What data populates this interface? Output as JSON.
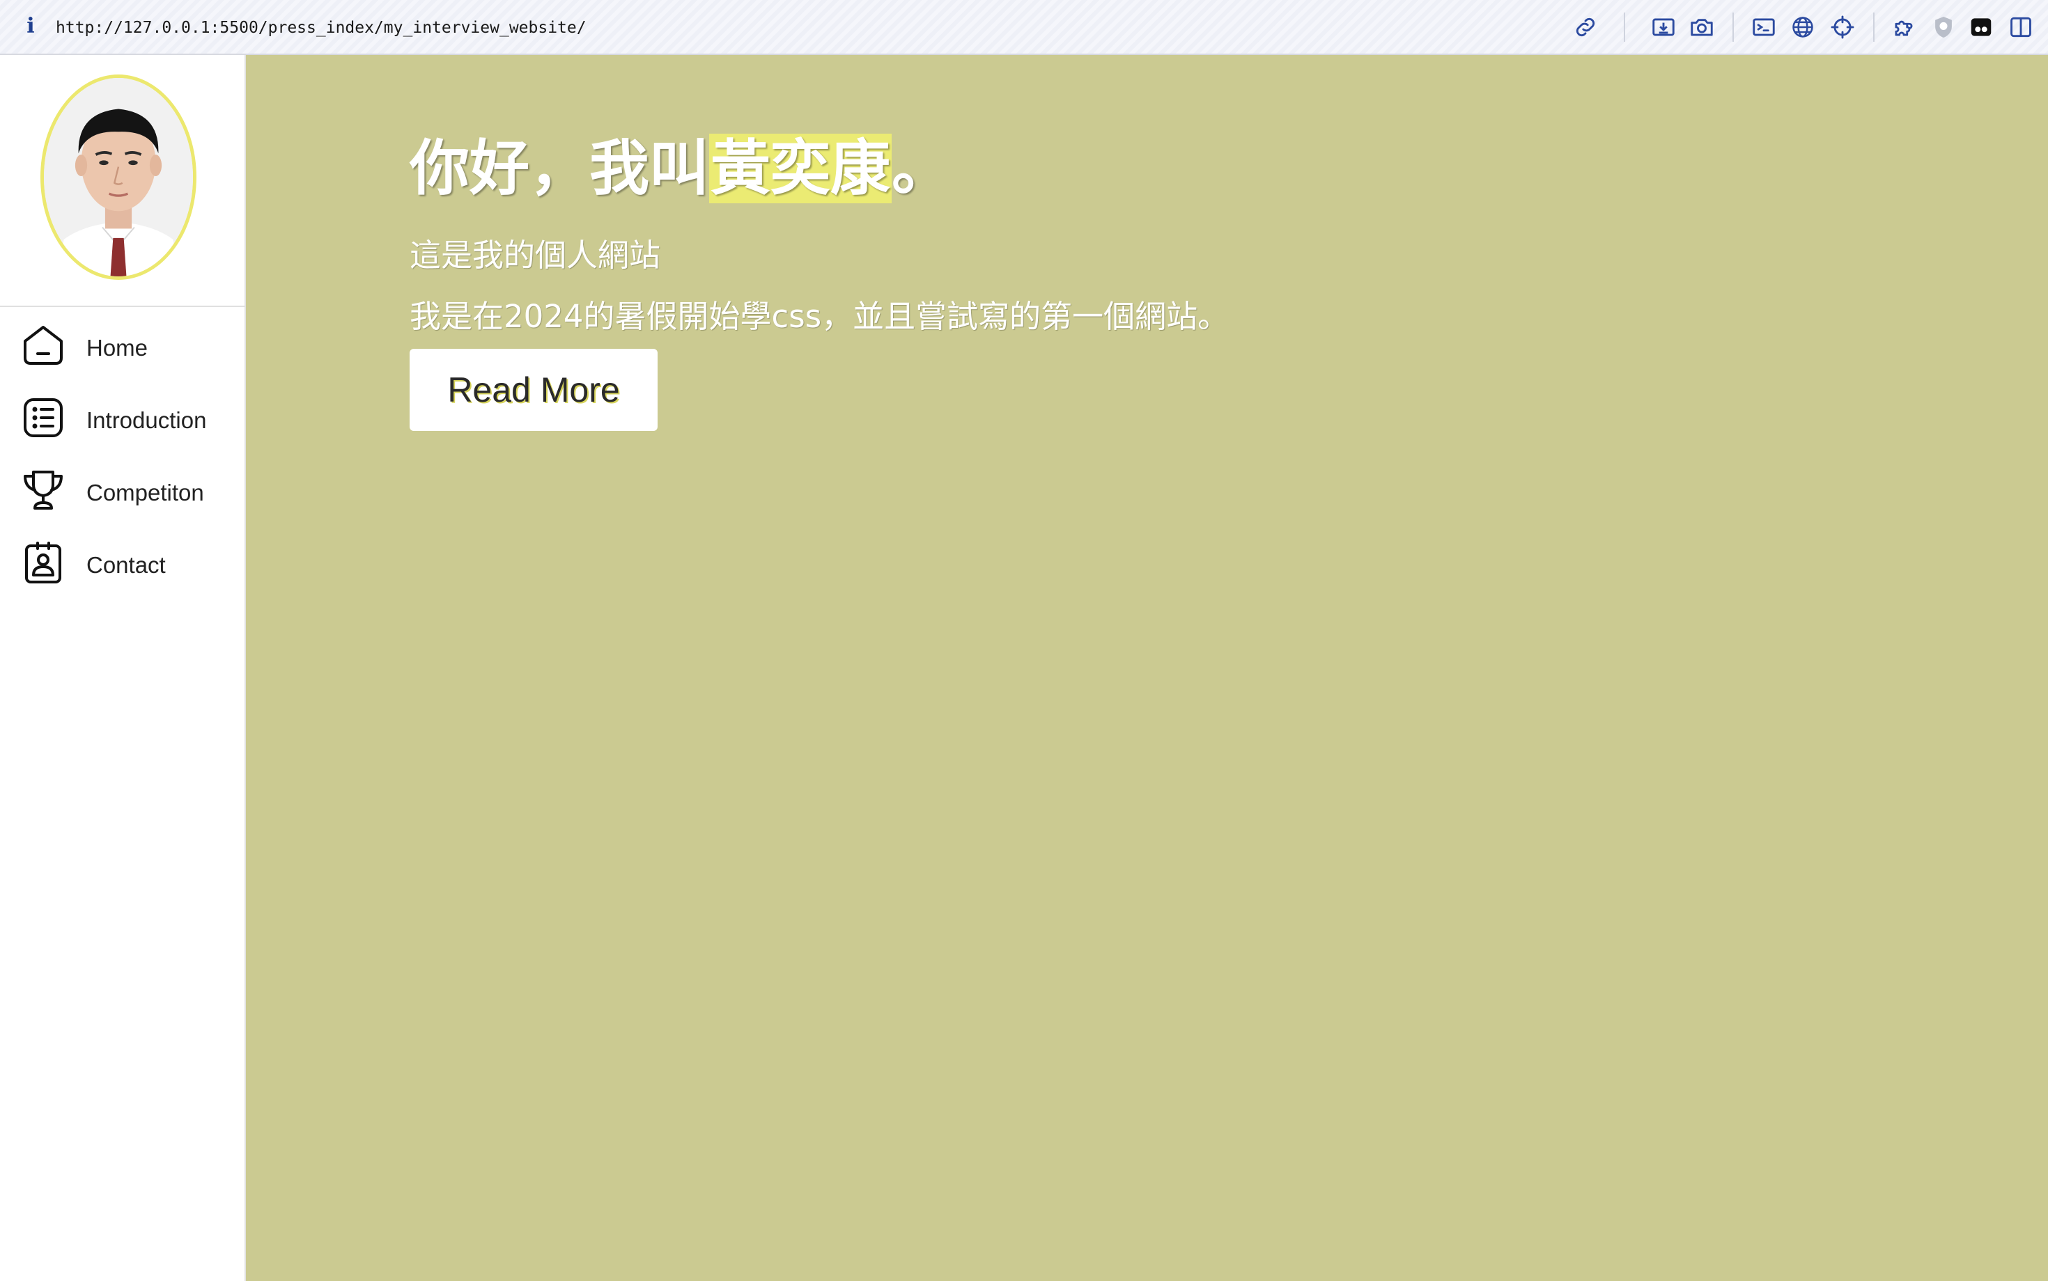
{
  "browser": {
    "url": "http://127.0.0.1:5500/press_index/my_interview_website/",
    "info_icon": "i",
    "toolbar_icons": [
      "link-icon",
      "download-icon",
      "camera-icon",
      "terminal-icon",
      "globe-icon",
      "crosshair-icon",
      "puzzle-icon",
      "shield-icon",
      "extension-icon",
      "split-view-icon"
    ]
  },
  "sidebar": {
    "avatar_border_color": "#ece86e",
    "items": [
      {
        "label": "Home",
        "icon": "home-icon"
      },
      {
        "label": "Introduction",
        "icon": "list-icon"
      },
      {
        "label": "Competiton",
        "icon": "trophy-icon"
      },
      {
        "label": "Contact",
        "icon": "contact-card-icon"
      }
    ]
  },
  "main": {
    "background_color": "#cbca91",
    "headline_prefix": "你好，我叫",
    "headline_name": "黃奕康",
    "headline_suffix": "。",
    "name_highlight_color": "#ebeb73",
    "line1": "這是我的個人網站",
    "line2": "我是在2024的暑假開始學css，並且嘗試寫的第一個網站。",
    "read_more_label": "Read More"
  }
}
